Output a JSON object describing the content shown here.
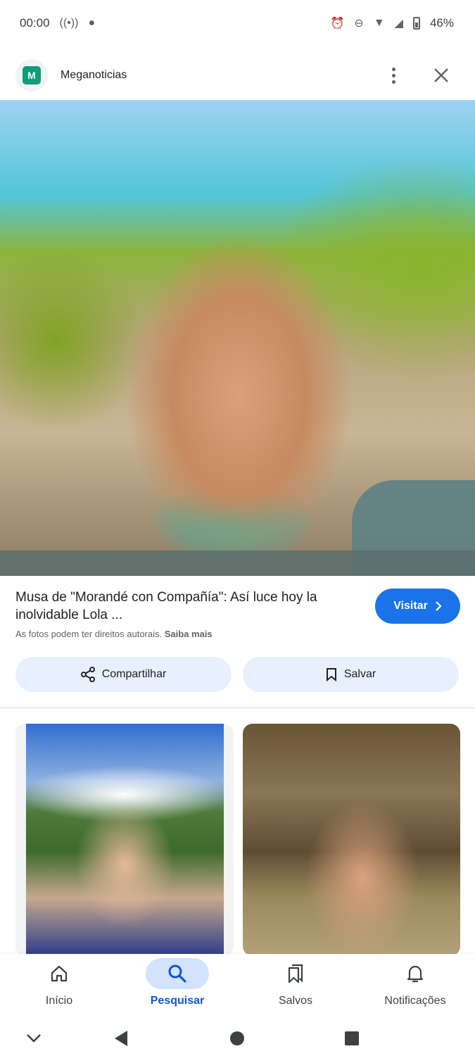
{
  "status_bar": {
    "time": "00:00",
    "battery": "46%",
    "icons": [
      "radio-icon",
      "assistant-icon",
      "alarm-icon",
      "dnd-icon",
      "wifi-icon",
      "signal-icon",
      "battery-icon"
    ]
  },
  "header": {
    "site_name": "Meganoticias",
    "site_logo_letter": "M",
    "more_icon": "more-vert-icon",
    "close_icon": "close-icon"
  },
  "result": {
    "title": "Musa de \"Morandé con Compañía\": Así luce hoy la inolvidable Lola ...",
    "visit_label": "Visitar",
    "copyright_text": "As fotos podem ter direitos autorais.",
    "learn_more": "Saiba mais"
  },
  "actions": {
    "share_label": "Compartilhar",
    "save_label": "Salvar"
  },
  "bottom_nav": {
    "items": [
      {
        "label": "Início",
        "icon": "home-icon"
      },
      {
        "label": "Pesquisar",
        "icon": "search-icon",
        "active": true
      },
      {
        "label": "Salvos",
        "icon": "bookmarks-icon"
      },
      {
        "label": "Notificações",
        "icon": "bell-icon"
      }
    ]
  },
  "colors": {
    "accent": "#1a73e8",
    "tonal_button": "#e8f0fe",
    "active_nav": "#0b57d0"
  }
}
